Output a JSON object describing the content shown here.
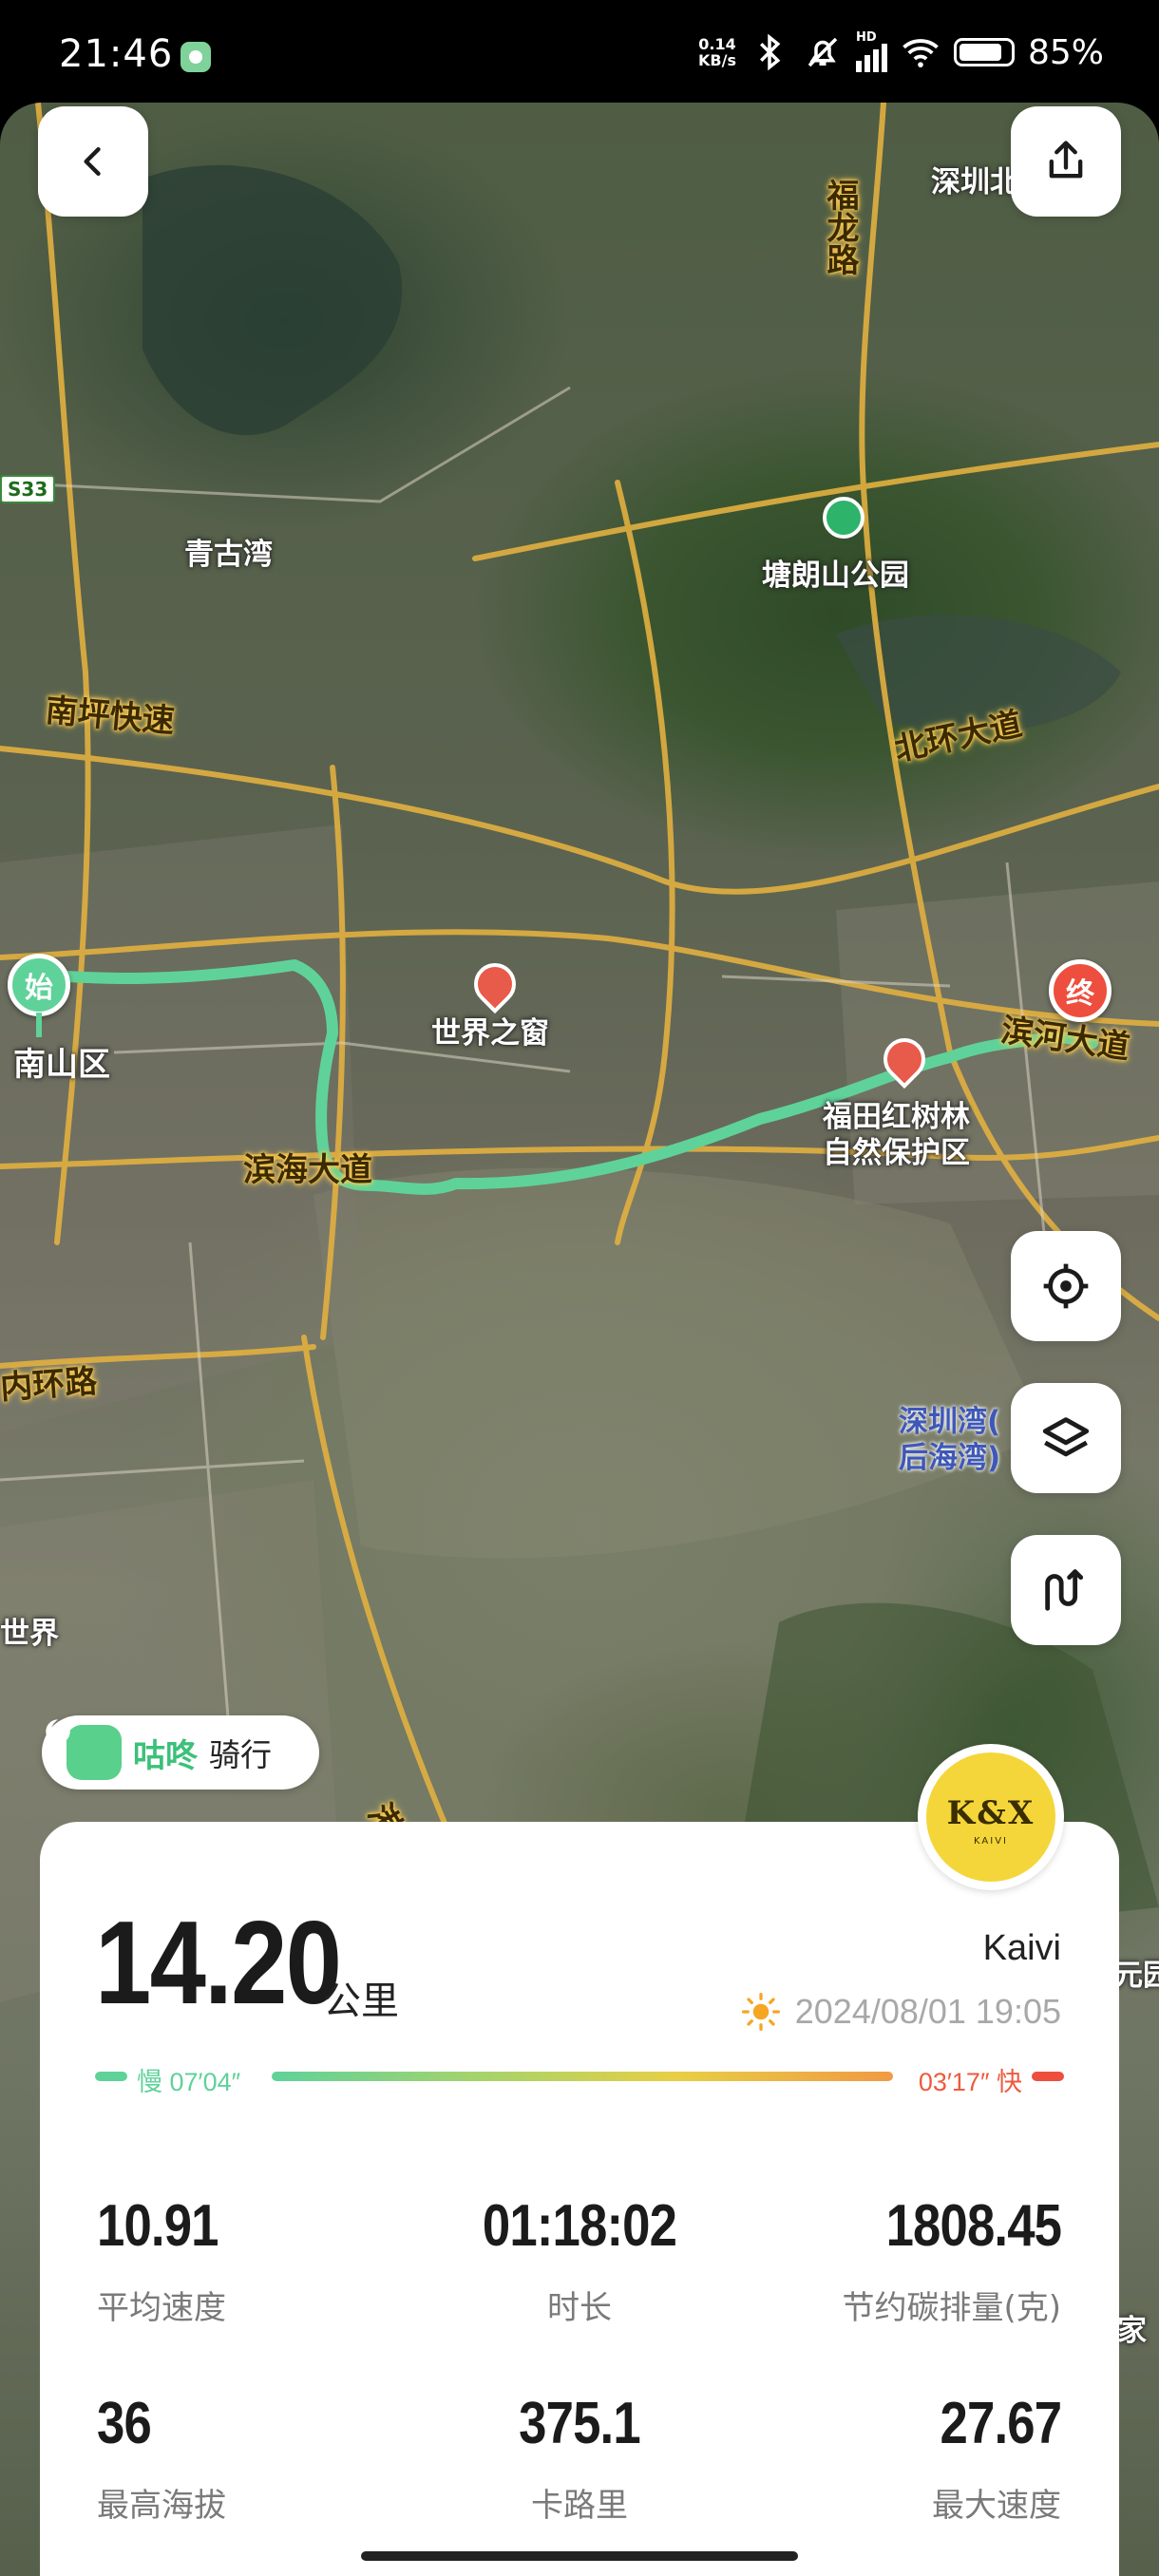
{
  "status_bar": {
    "time": "21:46",
    "net_speed_value": "0.14",
    "net_speed_unit": "KB/s",
    "signal_tag": "HD",
    "battery": "85%"
  },
  "map": {
    "labels": {
      "qinggu_bay": "青古湾",
      "tanglang_park": "塘朗山公园",
      "nanshan": "南山区",
      "window_of_world": "世界之窗",
      "futian_mangrove_line1": "福田红树林",
      "futian_mangrove_line2": "自然保护区",
      "shenzhen_bei": "深圳北",
      "shijie_edge": "世界",
      "yuan_edge": "元园",
      "jia_edge": "家"
    },
    "roads": {
      "s33": "S33",
      "nanping": "南坪快速",
      "beihuan": "北环大道",
      "fulong": "福龙路",
      "binhai_left": "滨海大道",
      "binhai_right": "滨河大道",
      "neihuan": "内环路",
      "gangshen": "港深西部公"
    },
    "bay": {
      "line1": "深圳湾(",
      "line2": "后海湾)"
    },
    "start_marker": "始",
    "end_marker": "终"
  },
  "brand": {
    "name": "咕咚",
    "activity": "骑行"
  },
  "avatar": {
    "text": "K&X",
    "sub": "KAIVI"
  },
  "summary": {
    "distance": "14.20",
    "distance_unit": "公里",
    "username": "Kaivi",
    "datetime": "2024/08/01 19:05",
    "pace_slow": "慢 07′04″",
    "pace_fast": "03′17″ 快"
  },
  "stats": [
    {
      "value": "10.91",
      "label": "平均速度"
    },
    {
      "value": "01:18:02",
      "label": "时长"
    },
    {
      "value": "1808.45",
      "label": "节约碳排量(克)"
    },
    {
      "value": "36",
      "label": "最高海拔"
    },
    {
      "value": "375.1",
      "label": "卡路里"
    },
    {
      "value": "27.67",
      "label": "最大速度"
    }
  ],
  "icons": {
    "back": "chevron-left-icon",
    "share": "share-icon",
    "locate": "locate-icon",
    "layers": "layers-icon",
    "route": "route-icon",
    "weather": "sun-icon"
  },
  "colors": {
    "route": "#5fd29a",
    "start": "#5fd29a",
    "end": "#ee4e3e",
    "brand": "#3cc07a",
    "avatar_bg": "#f5d63a"
  }
}
